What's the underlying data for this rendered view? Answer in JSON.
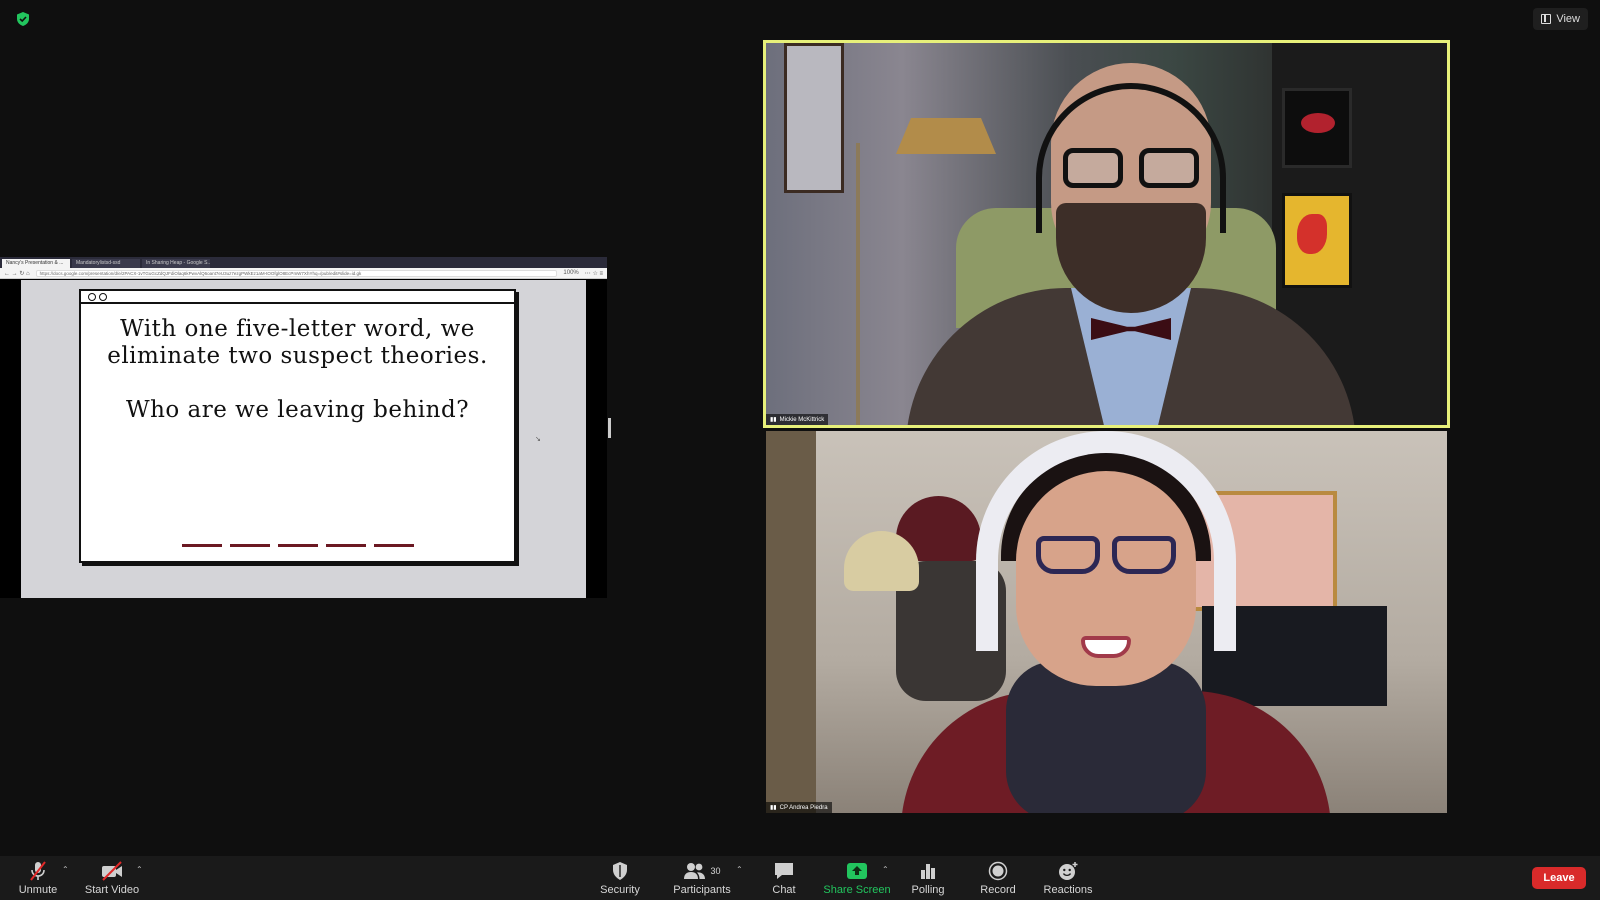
{
  "window": {
    "view_label": "View",
    "colors": {
      "background": "#0f0f0f",
      "active_speaker_border": "#e7f07a",
      "leave": "#d92a2a",
      "share_green": "#22c55e"
    }
  },
  "shared_screen": {
    "browser_tabs": [
      "Nancy's Presentation & ...",
      "Mandatorylistsd-ssd",
      "In Sharing Heap - Google S..."
    ],
    "url": "https://docs.google.com/presentation/d/e/2PACX-1vTGuGcZdQJFdiOlaq6kPwvAlQ6oant7eU3uz7ezgPWkEz1aM-tOOfglO8EcPmW7XhYhq=/pub/edit#slide=id.gk",
    "zoom": "100%",
    "slide": {
      "question_line1": "With one five-letter word, we eliminate two suspect theories.",
      "question_line2": "Who are we leaving behind?",
      "blank_count": 5
    }
  },
  "participants": [
    {
      "name": "Mickie McKittrick",
      "active_speaker": true
    },
    {
      "name": "CP Andrea Piedra",
      "active_speaker": false
    }
  ],
  "toolbar": {
    "unmute": "Unmute",
    "start_video": "Start Video",
    "security": "Security",
    "participants": "Participants",
    "participants_count": "30",
    "chat": "Chat",
    "share_screen": "Share Screen",
    "polling": "Polling",
    "record": "Record",
    "reactions": "Reactions",
    "leave": "Leave"
  }
}
